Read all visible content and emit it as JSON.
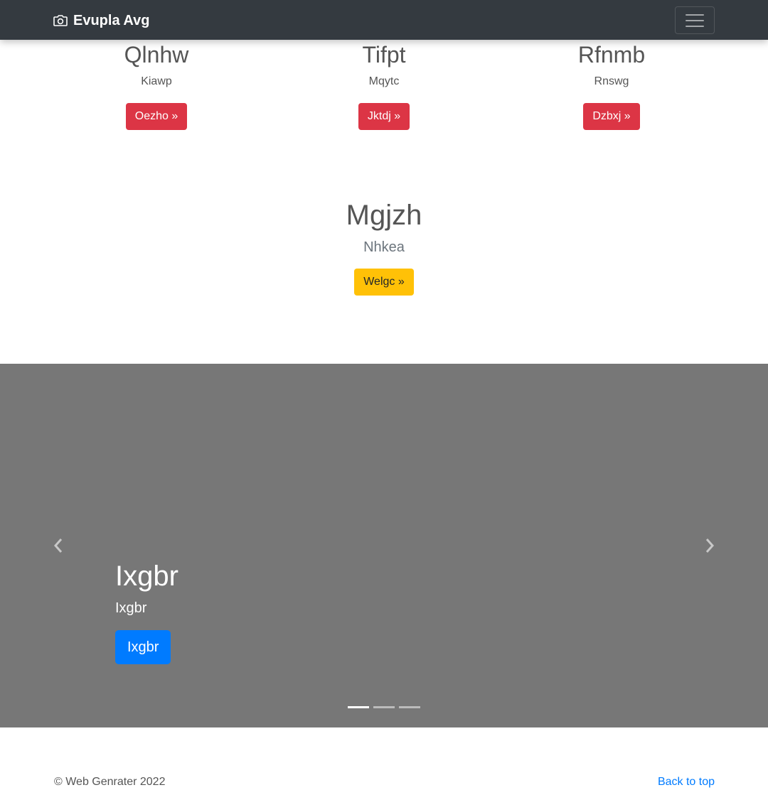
{
  "navbar": {
    "brand": "Evupla Avg",
    "brand_icon": "camera-icon",
    "toggler_icon": "hamburger-icon"
  },
  "columns": [
    {
      "heading": "Qlnhw",
      "text": "Kiawp",
      "button": "Oezho »"
    },
    {
      "heading": "Tifpt",
      "text": "Mqytc",
      "button": "Jktdj »"
    },
    {
      "heading": "Rfnmb",
      "text": "Rnswg",
      "button": "Dzbxj »"
    }
  ],
  "feature": {
    "heading": "Mgjzh",
    "lead": "Nhkea",
    "button": "Welgc »"
  },
  "carousel": {
    "caption_heading": "Ixgbr",
    "caption_text": "Ixgbr",
    "caption_button": "Ixgbr",
    "prev_icon": "chevron-left-icon",
    "next_icon": "chevron-right-icon",
    "indicator_count": 3,
    "active_indicator": 1
  },
  "footer": {
    "copyright": "© Web Genrater 2022",
    "back_to_top": "Back to top"
  },
  "colors": {
    "navbar": "#343a40",
    "danger": "#dc3545",
    "warning": "#ffc107",
    "primary": "#007bff",
    "carousel_bg": "#777777"
  }
}
